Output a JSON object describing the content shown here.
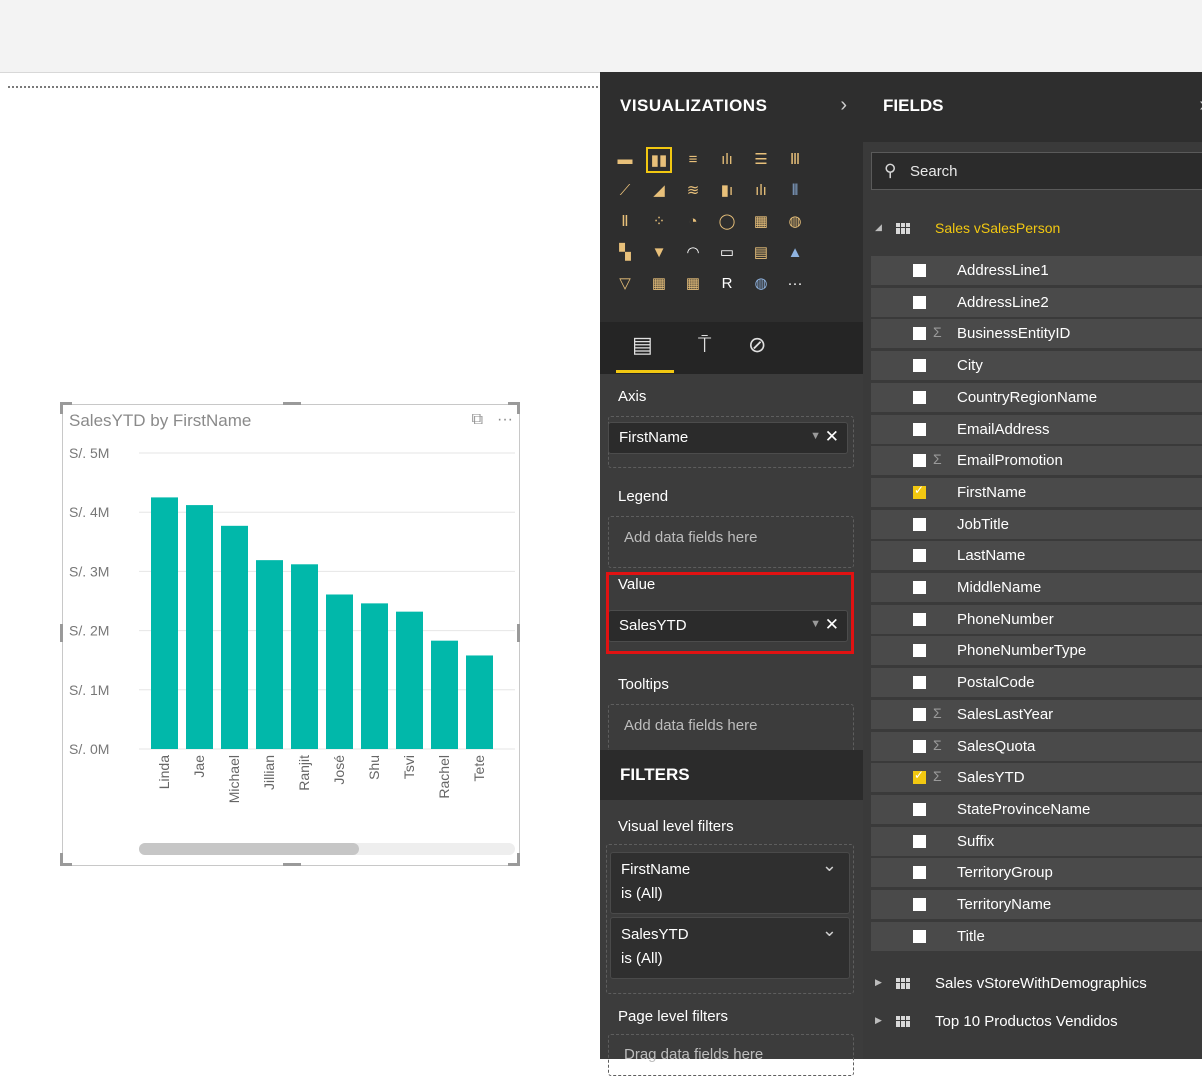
{
  "visual": {
    "title": "SalesYTD by FirstName",
    "focus_icon": "focus-mode-icon",
    "more_label": "···"
  },
  "chart_data": {
    "type": "bar",
    "title": "SalesYTD by FirstName",
    "categories": [
      "Linda",
      "Jae",
      "Michael",
      "Jillian",
      "Ranjit",
      "José",
      "Shu",
      "Tsvi",
      "Rachel",
      "Tete"
    ],
    "values": [
      4.25,
      4.12,
      3.77,
      3.19,
      3.12,
      2.61,
      2.46,
      2.32,
      1.83,
      1.58
    ],
    "ylim": [
      0,
      5
    ],
    "yticks": [
      "S/. 0M",
      "S/. 1M",
      "S/. 2M",
      "S/. 3M",
      "S/. 4M",
      "S/. 5M"
    ],
    "color": "#01b8aa",
    "grid": true
  },
  "visualizations": {
    "title": "VISUALIZATIONS",
    "chevron": "›",
    "icons": [
      "▬",
      "▮▮",
      "≡",
      "ılı",
      "☰",
      "Ⅲ",
      "⟋",
      "◢",
      "≋",
      "▮ı",
      "ılı",
      "⦀",
      "Ⅱ",
      "⁘",
      "◔",
      "◯",
      "▦",
      "◍",
      "▚",
      "▼",
      "◠",
      "▭",
      "▤",
      "▲",
      "▽",
      "▦",
      "▦",
      "R",
      "◍",
      "···"
    ],
    "tools": [
      "fields-tab-icon",
      "format-roller-icon",
      "analytics-icon"
    ],
    "axis": {
      "label": "Axis",
      "field": "FirstName"
    },
    "legend": {
      "label": "Legend",
      "placeholder": "Add data fields here"
    },
    "value": {
      "label": "Value",
      "field": "SalesYTD"
    },
    "tooltips": {
      "label": "Tooltips",
      "placeholder": "Add data fields here"
    }
  },
  "filters": {
    "title": "FILTERS",
    "visual_level_label": "Visual level filters",
    "cards": [
      {
        "name": "FirstName",
        "state": "is (All)"
      },
      {
        "name": "SalesYTD",
        "state": "is (All)"
      }
    ],
    "page_level_label": "Page level filters",
    "page_drop": "Drag data fields here"
  },
  "fields": {
    "title": "FIELDS",
    "chevron": "›",
    "search_placeholder": "Search",
    "table_open": "Sales vSalesPerson",
    "items": [
      {
        "name": "AddressLine1",
        "sigma": "",
        "checked": false
      },
      {
        "name": "AddressLine2",
        "sigma": "",
        "checked": false
      },
      {
        "name": "BusinessEntityID",
        "sigma": "Σ",
        "checked": false
      },
      {
        "name": "City",
        "sigma": "",
        "checked": false
      },
      {
        "name": "CountryRegionName",
        "sigma": "",
        "checked": false
      },
      {
        "name": "EmailAddress",
        "sigma": "",
        "checked": false
      },
      {
        "name": "EmailPromotion",
        "sigma": "Σ",
        "checked": false
      },
      {
        "name": "FirstName",
        "sigma": "",
        "checked": true
      },
      {
        "name": "JobTitle",
        "sigma": "",
        "checked": false
      },
      {
        "name": "LastName",
        "sigma": "",
        "checked": false
      },
      {
        "name": "MiddleName",
        "sigma": "",
        "checked": false
      },
      {
        "name": "PhoneNumber",
        "sigma": "",
        "checked": false
      },
      {
        "name": "PhoneNumberType",
        "sigma": "",
        "checked": false
      },
      {
        "name": "PostalCode",
        "sigma": "",
        "checked": false
      },
      {
        "name": "SalesLastYear",
        "sigma": "Σ",
        "checked": false
      },
      {
        "name": "SalesQuota",
        "sigma": "Σ",
        "checked": false
      },
      {
        "name": "SalesYTD",
        "sigma": "Σ",
        "checked": true
      },
      {
        "name": "StateProvinceName",
        "sigma": "",
        "checked": false
      },
      {
        "name": "Suffix",
        "sigma": "",
        "checked": false
      },
      {
        "name": "TerritoryGroup",
        "sigma": "",
        "checked": false
      },
      {
        "name": "TerritoryName",
        "sigma": "",
        "checked": false
      },
      {
        "name": "Title",
        "sigma": "",
        "checked": false
      }
    ],
    "other_tables": [
      "Sales vStoreWithDemographics",
      "Top 10 Productos Vendidos"
    ]
  },
  "colors": {
    "accent": "#f2c811",
    "bar": "#01b8aa",
    "highlight": "#e11212",
    "pane_bg": "#3c3c3c"
  }
}
